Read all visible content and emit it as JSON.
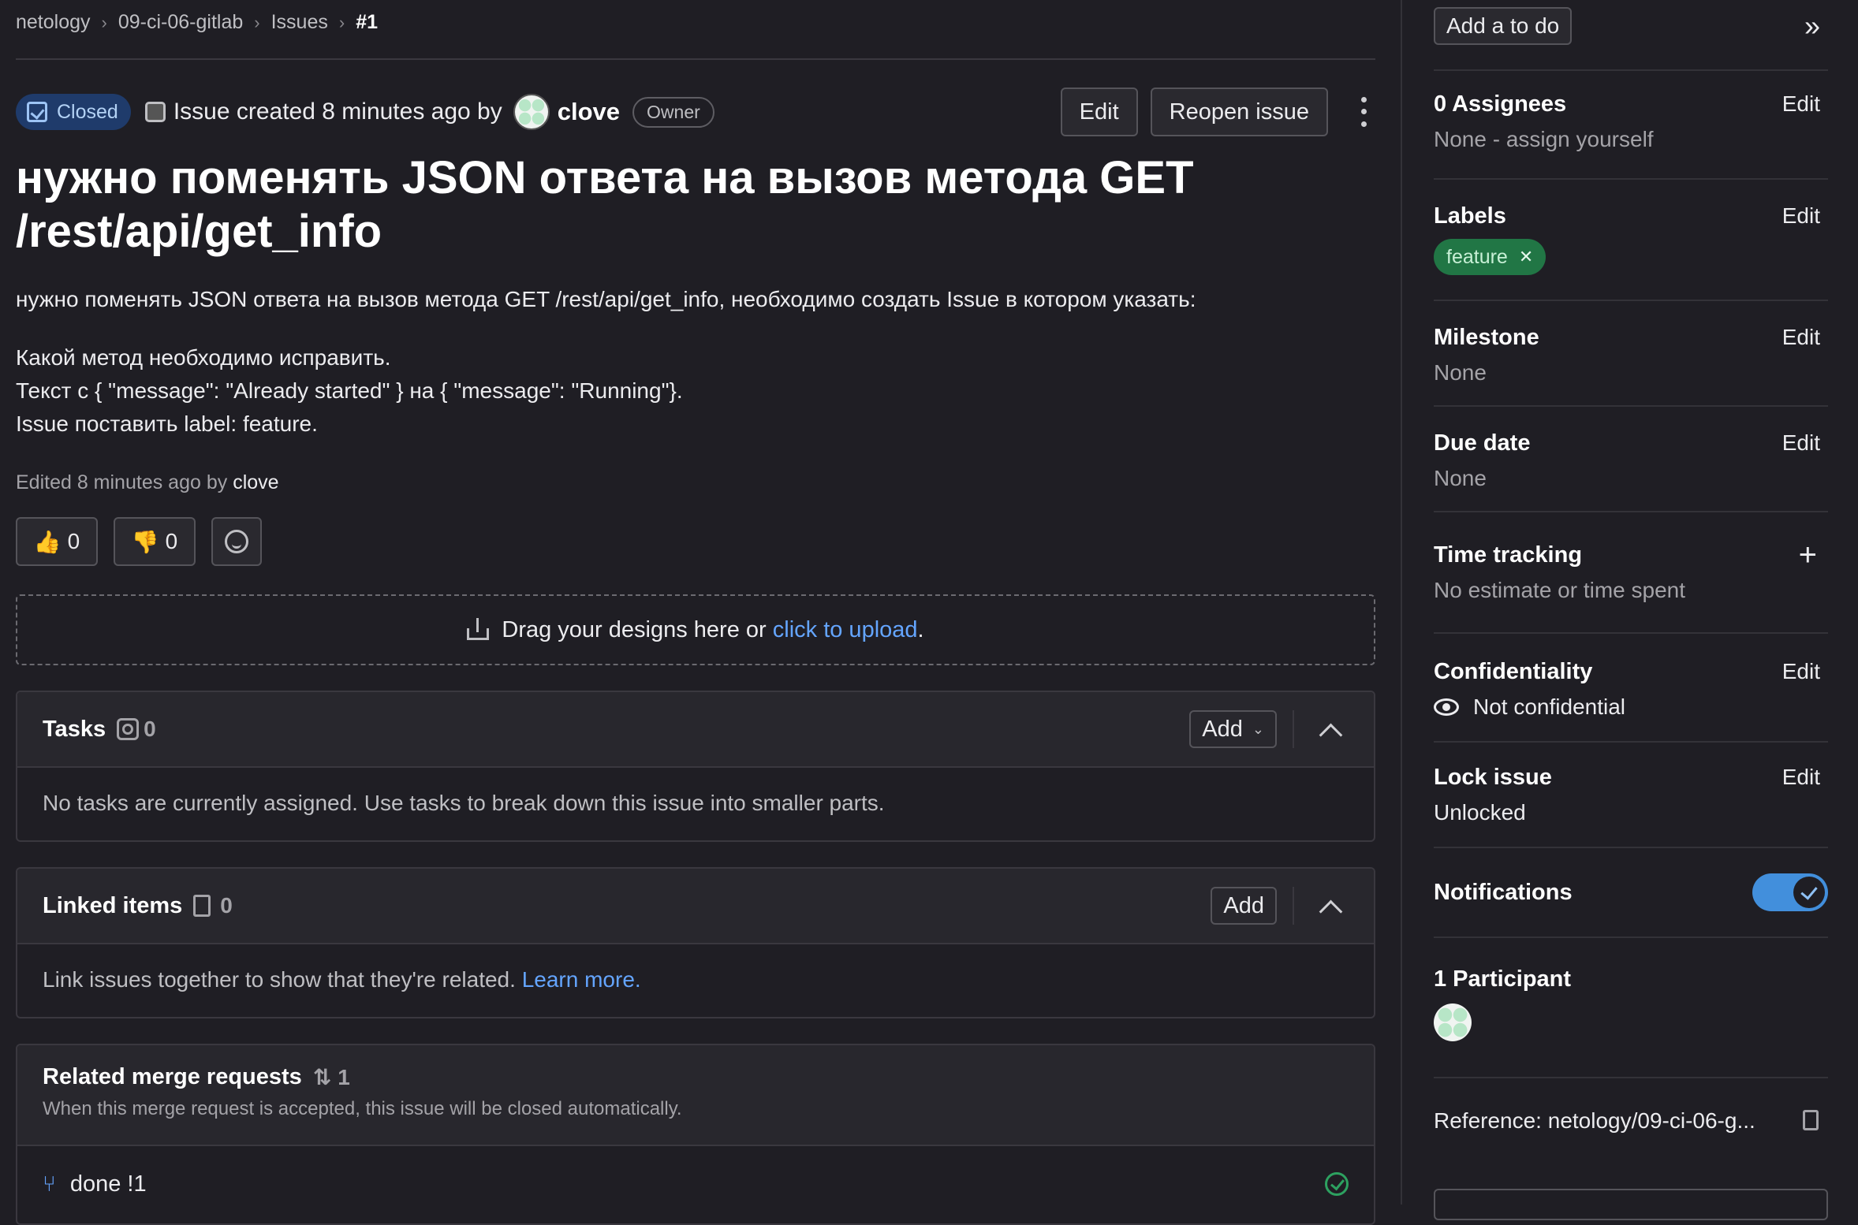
{
  "breadcrumb": [
    "netology",
    "09-ci-06-gitlab",
    "Issues",
    "#1"
  ],
  "issue": {
    "status": "Closed",
    "created_text": "Issue created 8 minutes ago by",
    "author": "clove",
    "author_role": "Owner",
    "edit_label": "Edit",
    "reopen_label": "Reopen issue",
    "title": "нужно поменять JSON ответа на вызов метода GET /rest/api/get_info",
    "description": [
      "нужно поменять JSON ответа на вызов метода GET /rest/api/get_info, необходимо создать Issue в котором указать:",
      "Какой метод необходимо исправить.",
      "Текст с { \"message\": \"Already started\" } на { \"message\": \"Running\"}.",
      "Issue поставить label: feature."
    ],
    "edited_prefix": "Edited 8 minutes ago by",
    "edited_by": "clove"
  },
  "reactions": {
    "thumbs_up_icon": "👍",
    "thumbs_up_count": "0",
    "thumbs_down_icon": "👎",
    "thumbs_down_count": "0"
  },
  "dropzone": {
    "text": "Drag your designs here or",
    "link": "click to upload",
    "suffix": "."
  },
  "tasks": {
    "title": "Tasks",
    "count": "0",
    "add_label": "Add",
    "empty": "No tasks are currently assigned. Use tasks to break down this issue into smaller parts."
  },
  "linked": {
    "title": "Linked items",
    "count": "0",
    "add_label": "Add",
    "empty": "Link issues together to show that they're related.",
    "learn_more": "Learn more."
  },
  "related_mr": {
    "title": "Related merge requests",
    "count": "1",
    "subtitle": "When this merge request is accepted, this issue will be closed automatically.",
    "item_title": "done",
    "item_ref": "!1"
  },
  "sidebar": {
    "todo_label": "Add a to do",
    "assignees_title": "0 Assignees",
    "assignees_value": "None - assign yourself",
    "labels_title": "Labels",
    "label_name": "feature",
    "milestone_title": "Milestone",
    "milestone_value": "None",
    "due_title": "Due date",
    "due_value": "None",
    "time_title": "Time tracking",
    "time_value": "No estimate or time spent",
    "conf_title": "Confidentiality",
    "conf_value": "Not confidential",
    "lock_title": "Lock issue",
    "lock_value": "Unlocked",
    "notif_title": "Notifications",
    "notifications_on": true,
    "participants_title": "1 Participant",
    "reference": "Reference: netology/09-ci-06-g...",
    "edit_label": "Edit"
  },
  "colors": {
    "background": "#1f1e24",
    "closed_badge": "#1f3b6b",
    "label_feature": "#217645",
    "link": "#64a5ff",
    "toggle_on": "#428fdc"
  }
}
